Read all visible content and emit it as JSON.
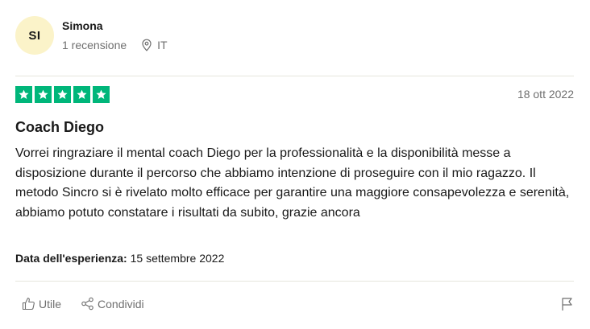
{
  "reviewer": {
    "initials": "SI",
    "name": "Simona",
    "reviews_count": "1 recensione",
    "country": "IT"
  },
  "review": {
    "rating": 5,
    "rating_max": 5,
    "date": "18 ott 2022",
    "title": "Coach Diego",
    "body": "Vorrei ringraziare il mental coach Diego per la professionalità e la disponibilità messe a disposizione durante il percorso che abbiamo intenzione di proseguire con il mio ragazzo. Il metodo Sincro si è rivelato molto efficace per garantire una maggiore consapevolezza e serenità, abbiamo potuto constatare i risultati da subito, grazie ancora",
    "experience_label": "Data dell'esperienza:",
    "experience_date": "15 settembre 2022"
  },
  "actions": {
    "useful_label": "Utile",
    "share_label": "Condividi"
  },
  "icons": [
    "location-pin-icon",
    "star-icon",
    "thumbs-up-icon",
    "share-icon",
    "flag-icon"
  ],
  "colors": {
    "star_green": "#00b67a",
    "avatar_bg": "#fbf3c9",
    "muted_text": "#6f6f6f"
  }
}
